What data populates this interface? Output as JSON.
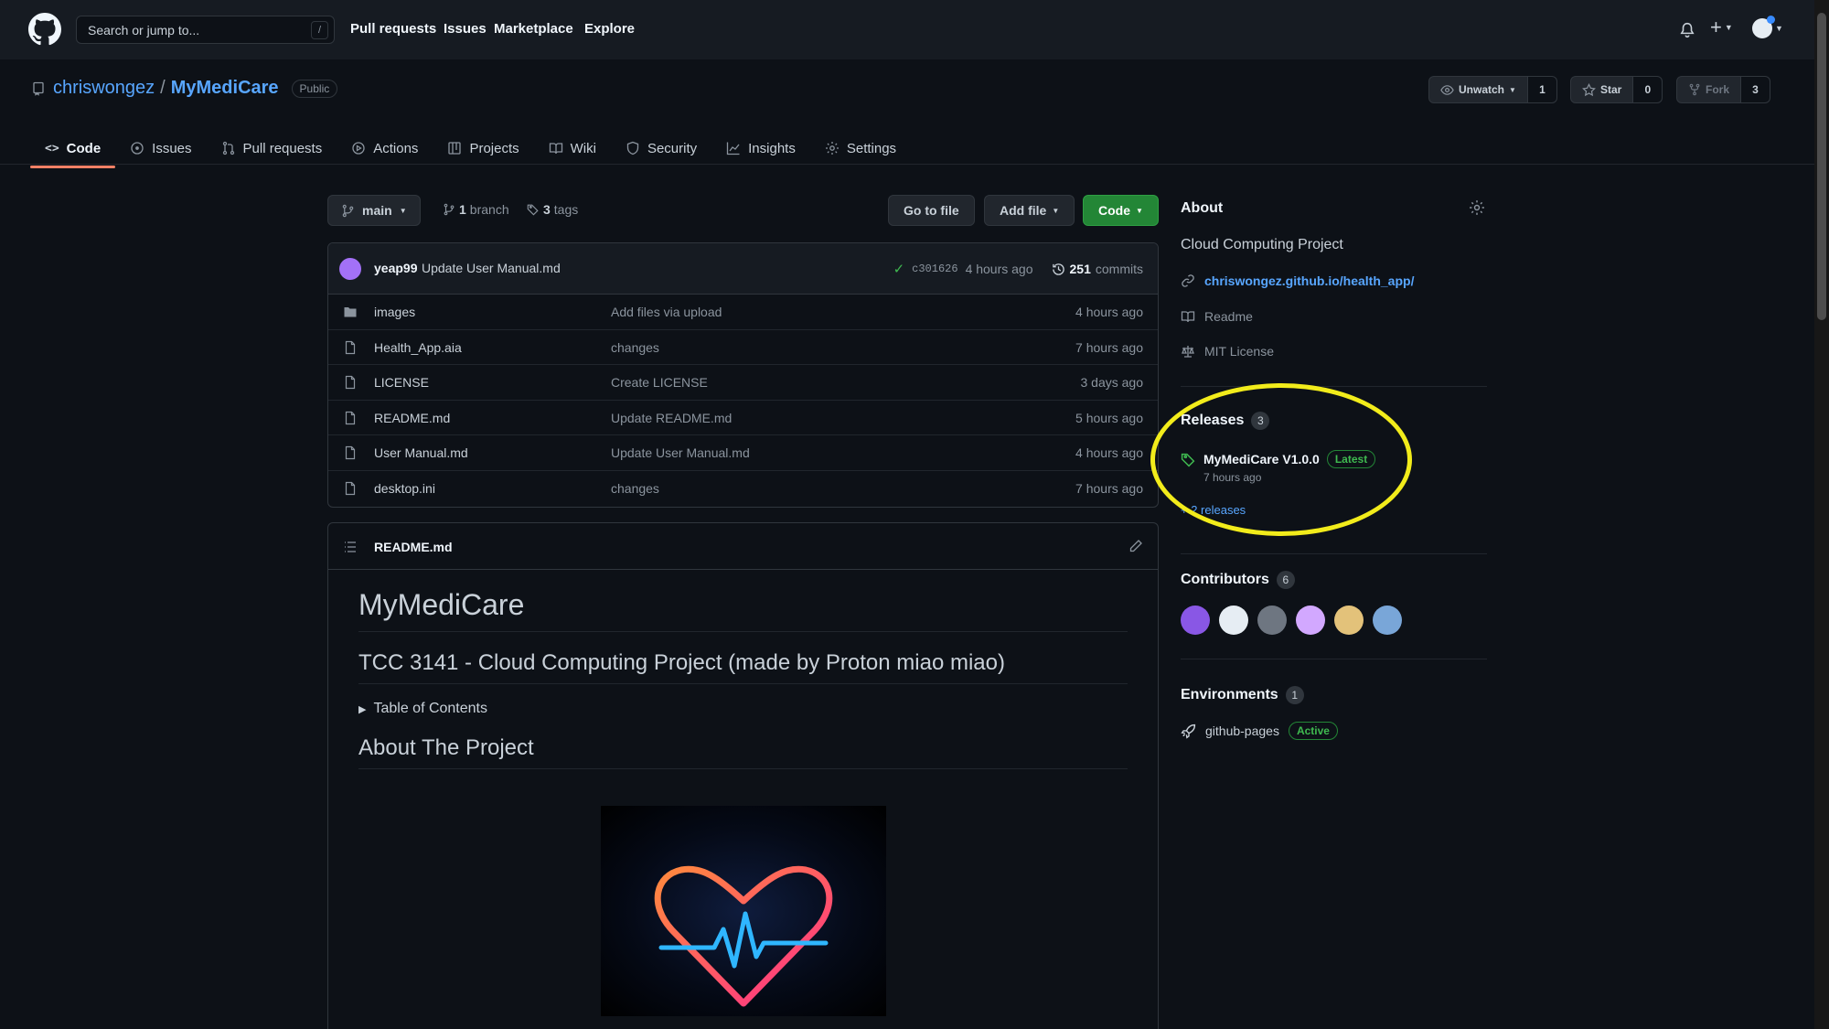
{
  "header": {
    "search_placeholder": "Search or jump to...",
    "search_shortcut": "/",
    "nav": [
      "Pull requests",
      "Issues",
      "Marketplace",
      "Explore"
    ]
  },
  "repo": {
    "owner": "chriswongez",
    "separator": "/",
    "name": "MyMediCare",
    "visibility": "Public",
    "watch_label": "Unwatch",
    "watch_count": "1",
    "star_label": "Star",
    "star_count": "0",
    "fork_label": "Fork",
    "fork_count": "3"
  },
  "tabs": [
    {
      "label": "Code",
      "icon": "code-icon",
      "active": true
    },
    {
      "label": "Issues",
      "icon": "issue-icon"
    },
    {
      "label": "Pull requests",
      "icon": "pull-request-icon"
    },
    {
      "label": "Actions",
      "icon": "play-icon"
    },
    {
      "label": "Projects",
      "icon": "table-icon"
    },
    {
      "label": "Wiki",
      "icon": "book-icon"
    },
    {
      "label": "Security",
      "icon": "shield-icon"
    },
    {
      "label": "Insights",
      "icon": "graph-icon"
    },
    {
      "label": "Settings",
      "icon": "gear-icon"
    }
  ],
  "toolbar": {
    "branch": "main",
    "branch_count": "1",
    "branch_word": "branch",
    "tag_count": "3",
    "tag_word": "tags",
    "go_to_file": "Go to file",
    "add_file": "Add file",
    "code": "Code"
  },
  "commit": {
    "author": "yeap99",
    "message": "Update User Manual.md",
    "sha": "c301626",
    "age": "4 hours ago",
    "count": "251",
    "count_word": "commits"
  },
  "files": [
    {
      "name": "images",
      "type": "folder",
      "message": "Add files via upload",
      "age": "4 hours ago"
    },
    {
      "name": "Health_App.aia",
      "type": "file",
      "message": "changes",
      "age": "7 hours ago"
    },
    {
      "name": "LICENSE",
      "type": "file",
      "message": "Create LICENSE",
      "age": "3 days ago"
    },
    {
      "name": "README.md",
      "type": "file",
      "message": "Update README.md",
      "age": "5 hours ago"
    },
    {
      "name": "User Manual.md",
      "type": "file",
      "message": "Update User Manual.md",
      "age": "4 hours ago"
    },
    {
      "name": "desktop.ini",
      "type": "file",
      "message": "changes",
      "age": "7 hours ago"
    }
  ],
  "readme": {
    "filename": "README.md",
    "h1": "MyMediCare",
    "h2": "TCC 3141 - Cloud Computing Project (made by Proton miao miao)",
    "details": "Table of Contents",
    "h2b": "About The Project"
  },
  "about": {
    "title": "About",
    "description": "Cloud Computing Project",
    "link": "chriswongez.github.io/health_app/",
    "readme": "Readme",
    "license": "MIT License"
  },
  "releases": {
    "title": "Releases",
    "count": "3",
    "latest_name": "MyMediCare V1.0.0",
    "latest_badge": "Latest",
    "latest_age": "7 hours ago",
    "more": "+ 2 releases"
  },
  "contributors": {
    "title": "Contributors",
    "count": "6",
    "avatars": [
      "#8957e5",
      "#e6edf3",
      "#6e7681",
      "#d2a8ff",
      "#e3c27a",
      "#79a6d8"
    ]
  },
  "environments": {
    "title": "Environments",
    "count": "1",
    "name": "github-pages",
    "status": "Active"
  },
  "colors": {
    "accent_blue": "#58a6ff",
    "green": "#238636",
    "highlight": "#f2ec1b",
    "tab_underline": "#f78166"
  }
}
